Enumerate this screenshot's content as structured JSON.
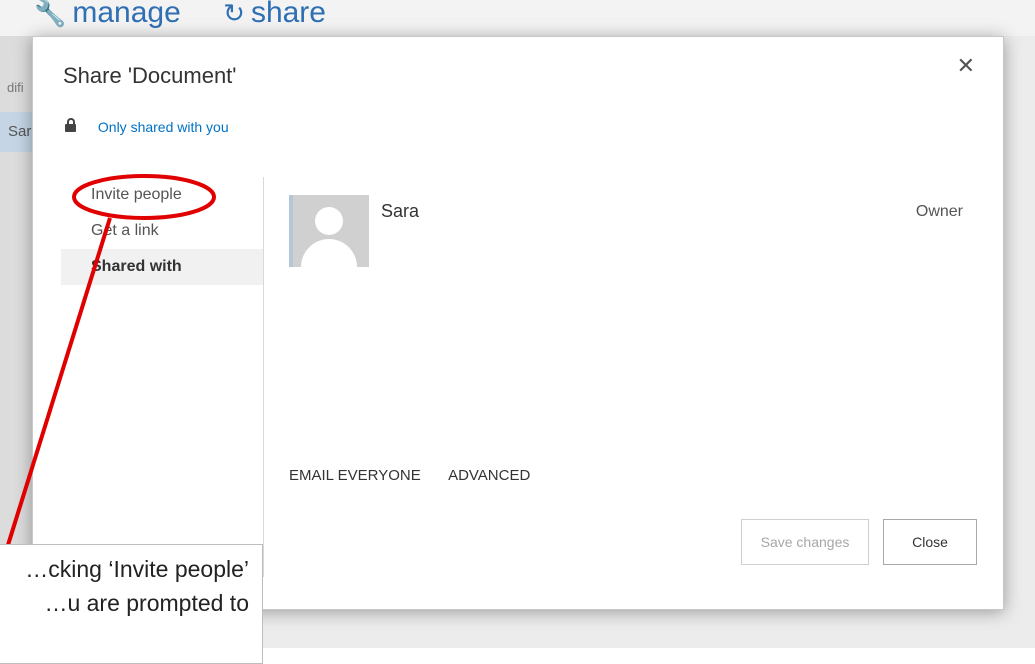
{
  "background": {
    "ribbon": [
      "manage",
      "share"
    ],
    "ribbon_icons": [
      "wrench-icon",
      "share-icon"
    ],
    "column_fragment": "difi",
    "row_fragment": "Sar"
  },
  "dialog": {
    "title": "Share 'Document'",
    "close_symbol": "✕",
    "privacy_text": "Only shared with you",
    "nav": [
      {
        "label": "Invite people"
      },
      {
        "label": "Get a link"
      },
      {
        "label": "Shared with"
      }
    ],
    "user": {
      "name": "Sara",
      "role": "Owner"
    },
    "actions": [
      "EMAIL EVERYONE",
      "ADVANCED"
    ],
    "buttons": {
      "save": "Save changes",
      "close": "Close"
    }
  },
  "annotation": {
    "callout_text": "…cking ‘Invite people’\n…u are prompted to",
    "highlight_color": "#e00000"
  }
}
